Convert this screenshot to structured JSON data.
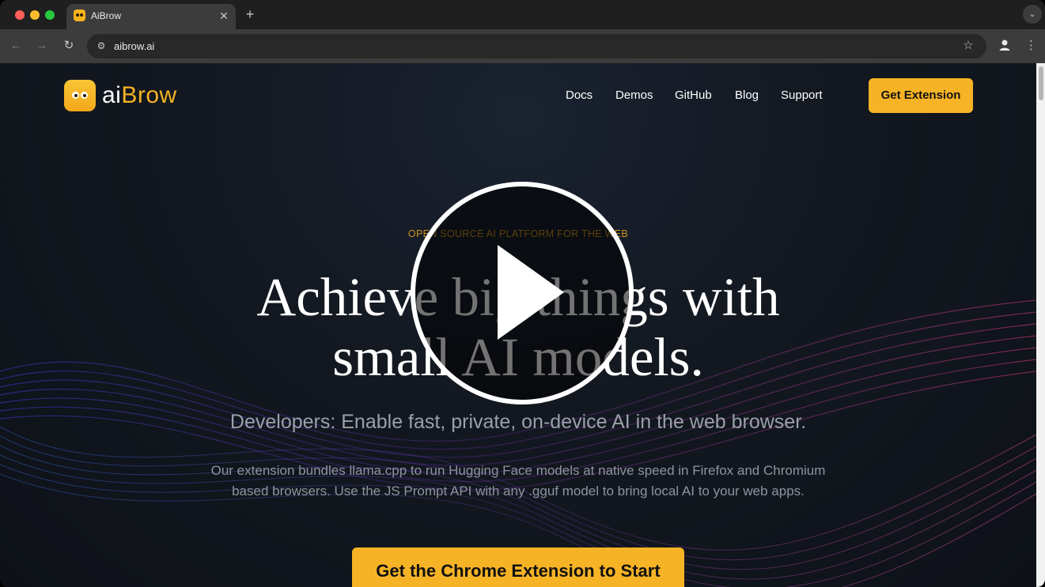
{
  "browser": {
    "tab_title": "AiBrow",
    "tab_close": "✕",
    "new_tab": "+",
    "tab_search": "⌄",
    "url": "aibrow.ai",
    "back": "←",
    "forward": "→",
    "reload": "↻",
    "site_info": "⚙",
    "bookmark": "☆",
    "menu": "⋮"
  },
  "site": {
    "logo_ai": "ai",
    "logo_brow": "Brow",
    "nav": [
      "Docs",
      "Demos",
      "GitHub",
      "Blog",
      "Support"
    ],
    "cta_top": "Get Extension"
  },
  "hero": {
    "eyebrow": "OPEN SOURCE AI PLATFORM FOR THE WEB",
    "headline_line1": "Achieve big things with",
    "headline_line2": "small AI models.",
    "subhead": "Developers: Enable fast, private, on-device AI  in the web browser.",
    "body_line1": "Our extension bundles llama.cpp to run Hugging Face models at native speed in Firefox and Chromium",
    "body_line2": "based browsers. Use the JS Prompt API with any .gguf model to bring local AI to your web apps.",
    "cta_main": "Get the Chrome Extension to Start"
  },
  "colors": {
    "accent": "#f6b325",
    "background": "#131820",
    "play_overlay": "#ffffff"
  },
  "icons": {
    "play": "play-icon",
    "profile": "profile-icon"
  }
}
